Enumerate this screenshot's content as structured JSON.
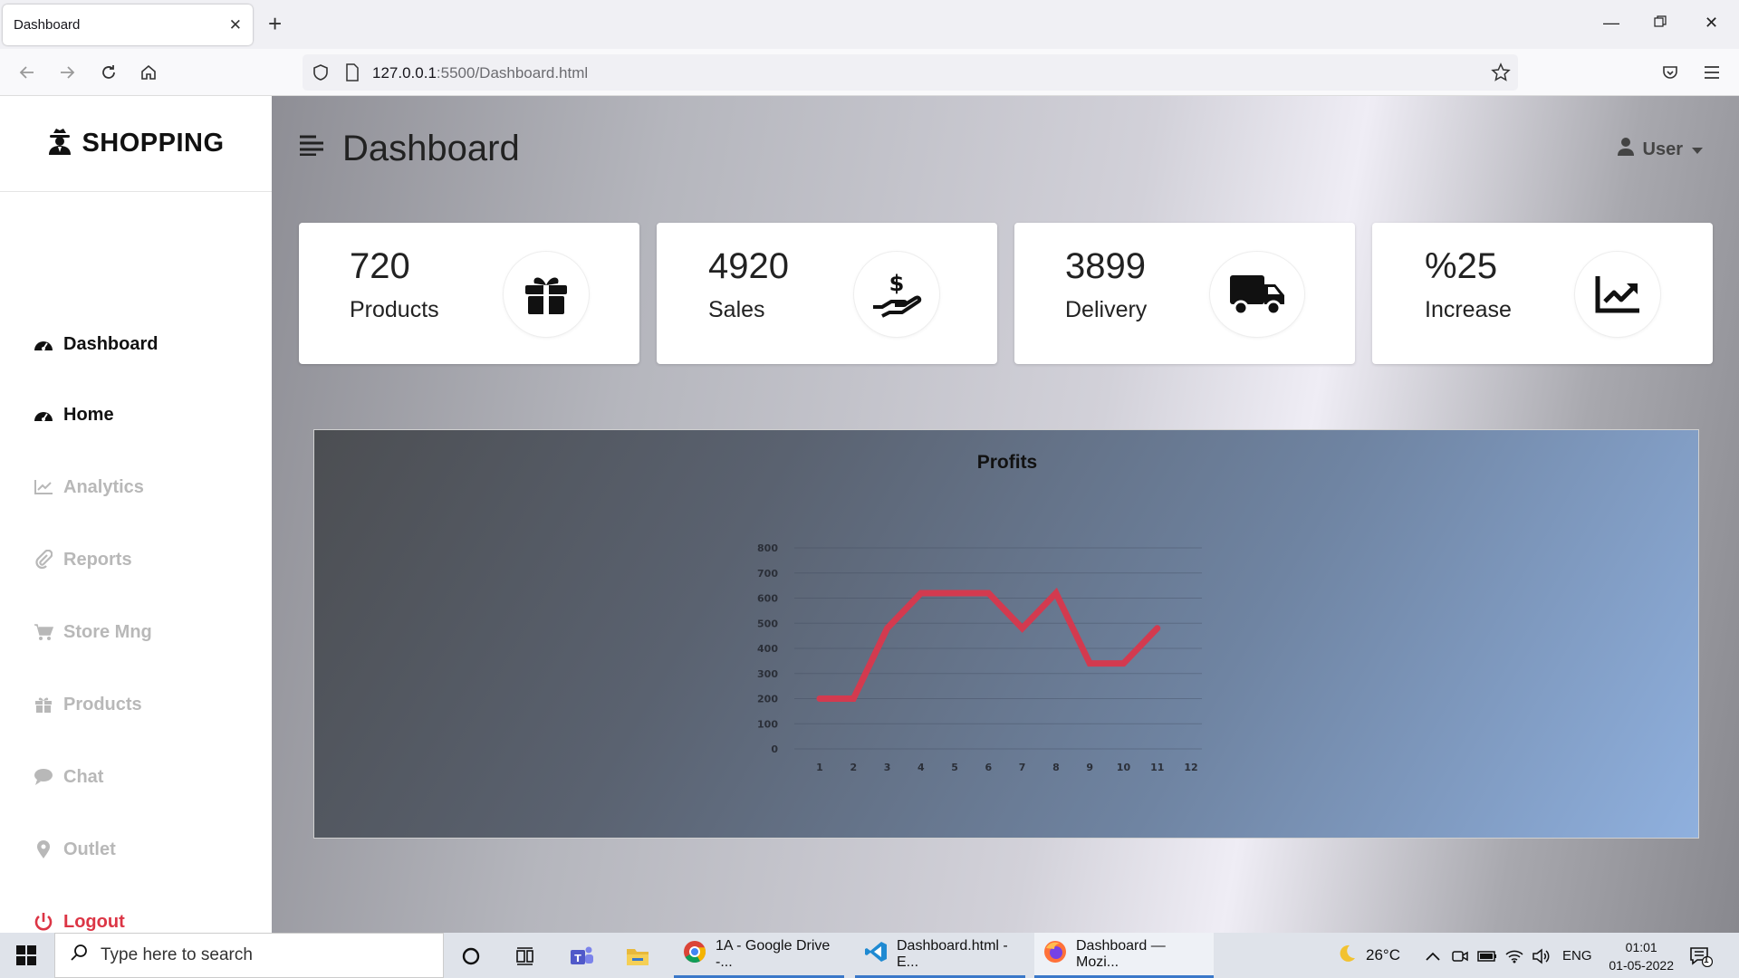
{
  "browser": {
    "tab_title": "Dashboard",
    "url_host": "127.0.0.1",
    "url_path": ":5500/Dashboard.html"
  },
  "sidebar": {
    "brand": "SHOPPING",
    "items": [
      {
        "label": "Dashboard",
        "icon": "gauge-icon",
        "state": "active"
      },
      {
        "label": "Home",
        "icon": "gauge-icon",
        "state": "active"
      },
      {
        "label": "Analytics",
        "icon": "line-chart-icon",
        "state": "muted"
      },
      {
        "label": "Reports",
        "icon": "paperclip-icon",
        "state": "muted"
      },
      {
        "label": "Store Mng",
        "icon": "cart-icon",
        "state": "muted"
      },
      {
        "label": "Products",
        "icon": "gift-icon",
        "state": "muted"
      },
      {
        "label": "Chat",
        "icon": "chat-icon",
        "state": "muted"
      },
      {
        "label": "Outlet",
        "icon": "map-pin-icon",
        "state": "muted"
      },
      {
        "label": "Logout",
        "icon": "power-icon",
        "state": "danger"
      }
    ]
  },
  "header": {
    "title": "Dashboard",
    "user_label": "User"
  },
  "cards": [
    {
      "value": "720",
      "label": "Products",
      "icon": "gift-icon"
    },
    {
      "value": "4920",
      "label": "Sales",
      "icon": "hand-dollar-icon"
    },
    {
      "value": "3899",
      "label": "Delivery",
      "icon": "truck-icon"
    },
    {
      "value": "%25",
      "label": "Increase",
      "icon": "trend-up-icon"
    }
  ],
  "chart_data": {
    "type": "line",
    "title": "Profits",
    "x": [
      "1",
      "2",
      "3",
      "4",
      "5",
      "6",
      "7",
      "8",
      "9",
      "10",
      "11",
      "12"
    ],
    "series": [
      {
        "values": [
          200,
          200,
          480,
          620,
          620,
          620,
          480,
          620,
          340,
          340,
          480,
          null
        ]
      }
    ],
    "ylim": [
      0,
      800
    ],
    "yticks": [
      "0",
      "100",
      "200",
      "300",
      "400",
      "500",
      "600",
      "700",
      "800"
    ],
    "grid": true,
    "line_color": "#d33a4f"
  },
  "taskbar": {
    "search_placeholder": "Type here to search",
    "apps": [
      {
        "label": "1A - Google Drive -..."
      },
      {
        "label": "Dashboard.html - E..."
      },
      {
        "label": "Dashboard — Mozi..."
      }
    ],
    "weather": "26°C",
    "lang": "ENG",
    "time": "01:01",
    "date": "01-05-2022",
    "notification_count": "1"
  }
}
